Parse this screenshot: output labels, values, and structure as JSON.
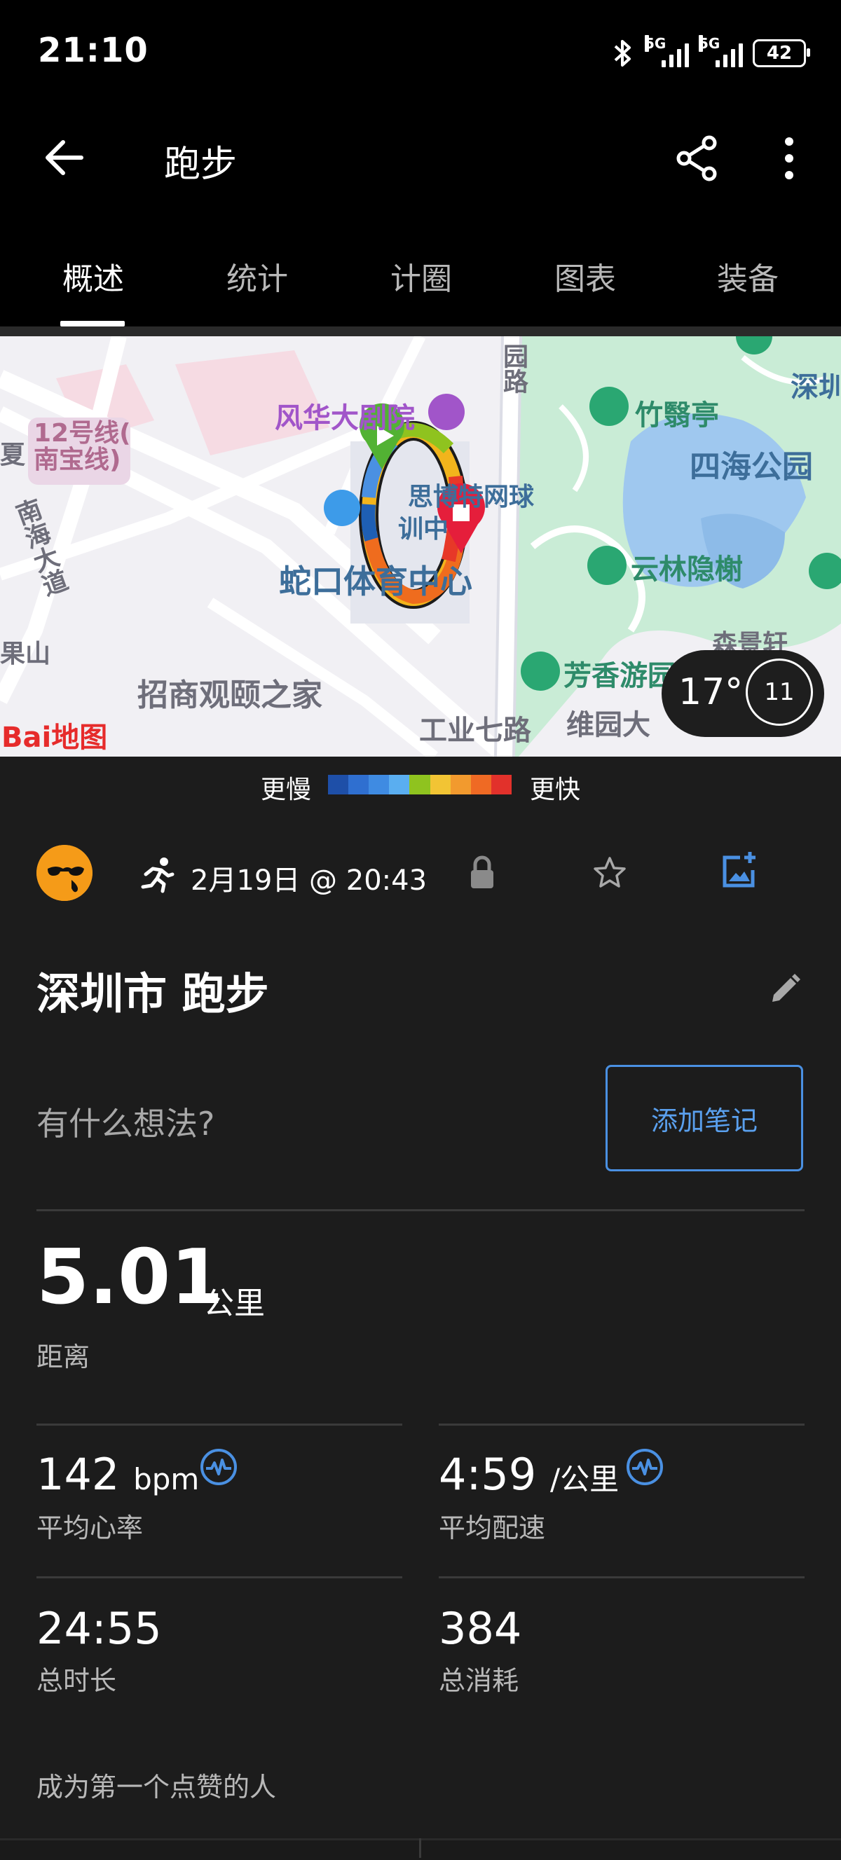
{
  "status_bar": {
    "time": "21:10",
    "network1": "5G",
    "network2": "5G",
    "battery": "42"
  },
  "app_bar": {
    "title": "跑步"
  },
  "tabs": [
    "概述",
    "统计",
    "计圈",
    "图表",
    "装备"
  ],
  "map": {
    "labels": {
      "theatre": "风华大剧院",
      "line12": "12号线(\n南宝线)",
      "zhuyi": "竹翳亭",
      "sihai": "四海公园",
      "tennis": "思博特网球",
      "train": "训中",
      "sports": "蛇口体育中心",
      "yunlin": "云林隐榭",
      "nanhai": "南海大道",
      "guoshan": "果山",
      "zhaoshang": "招商观颐之家",
      "fangxiang": "芳香游园",
      "weiyuan": "维园大",
      "industry": "工业七路",
      "road": "园路",
      "xia": "夏",
      "shen": "深圳",
      "yunxuan": "森景轩"
    },
    "weather_temp": "17°",
    "weather_clock": "11",
    "logo": "Bai地图",
    "route_colors": [
      "#f2b41c",
      "#ef6c1e",
      "#e73828",
      "#8fc31f",
      "#4a90e2",
      "#1e5fb4"
    ]
  },
  "legend": {
    "slower": "更慢",
    "faster": "更快",
    "colors": [
      "#1e4fa8",
      "#2f6fd0",
      "#3f8be2",
      "#5aaef0",
      "#8fc31f",
      "#f2c434",
      "#f29a2e",
      "#ef6a24",
      "#e2312b"
    ]
  },
  "activity": {
    "date": "2月19日 @ 20:43",
    "name": "深圳市 跑步",
    "note_prompt": "有什么想法?",
    "note_button": "添加笔记"
  },
  "distance": {
    "value": "5.01",
    "unit": "公里",
    "label": "距离"
  },
  "stats": {
    "heart_rate": {
      "value": "142",
      "unit": "bpm",
      "label": "平均心率"
    },
    "pace": {
      "value": "4:59",
      "unit": "/公里",
      "label": "平均配速"
    },
    "duration": {
      "value": "24:55",
      "label": "总时长"
    },
    "calories": {
      "value": "384",
      "label": "总消耗"
    }
  },
  "likes_text": "成为第一个点赞的人",
  "colors": {
    "accent": "#4a90e2",
    "background": "#1c1c1c"
  }
}
